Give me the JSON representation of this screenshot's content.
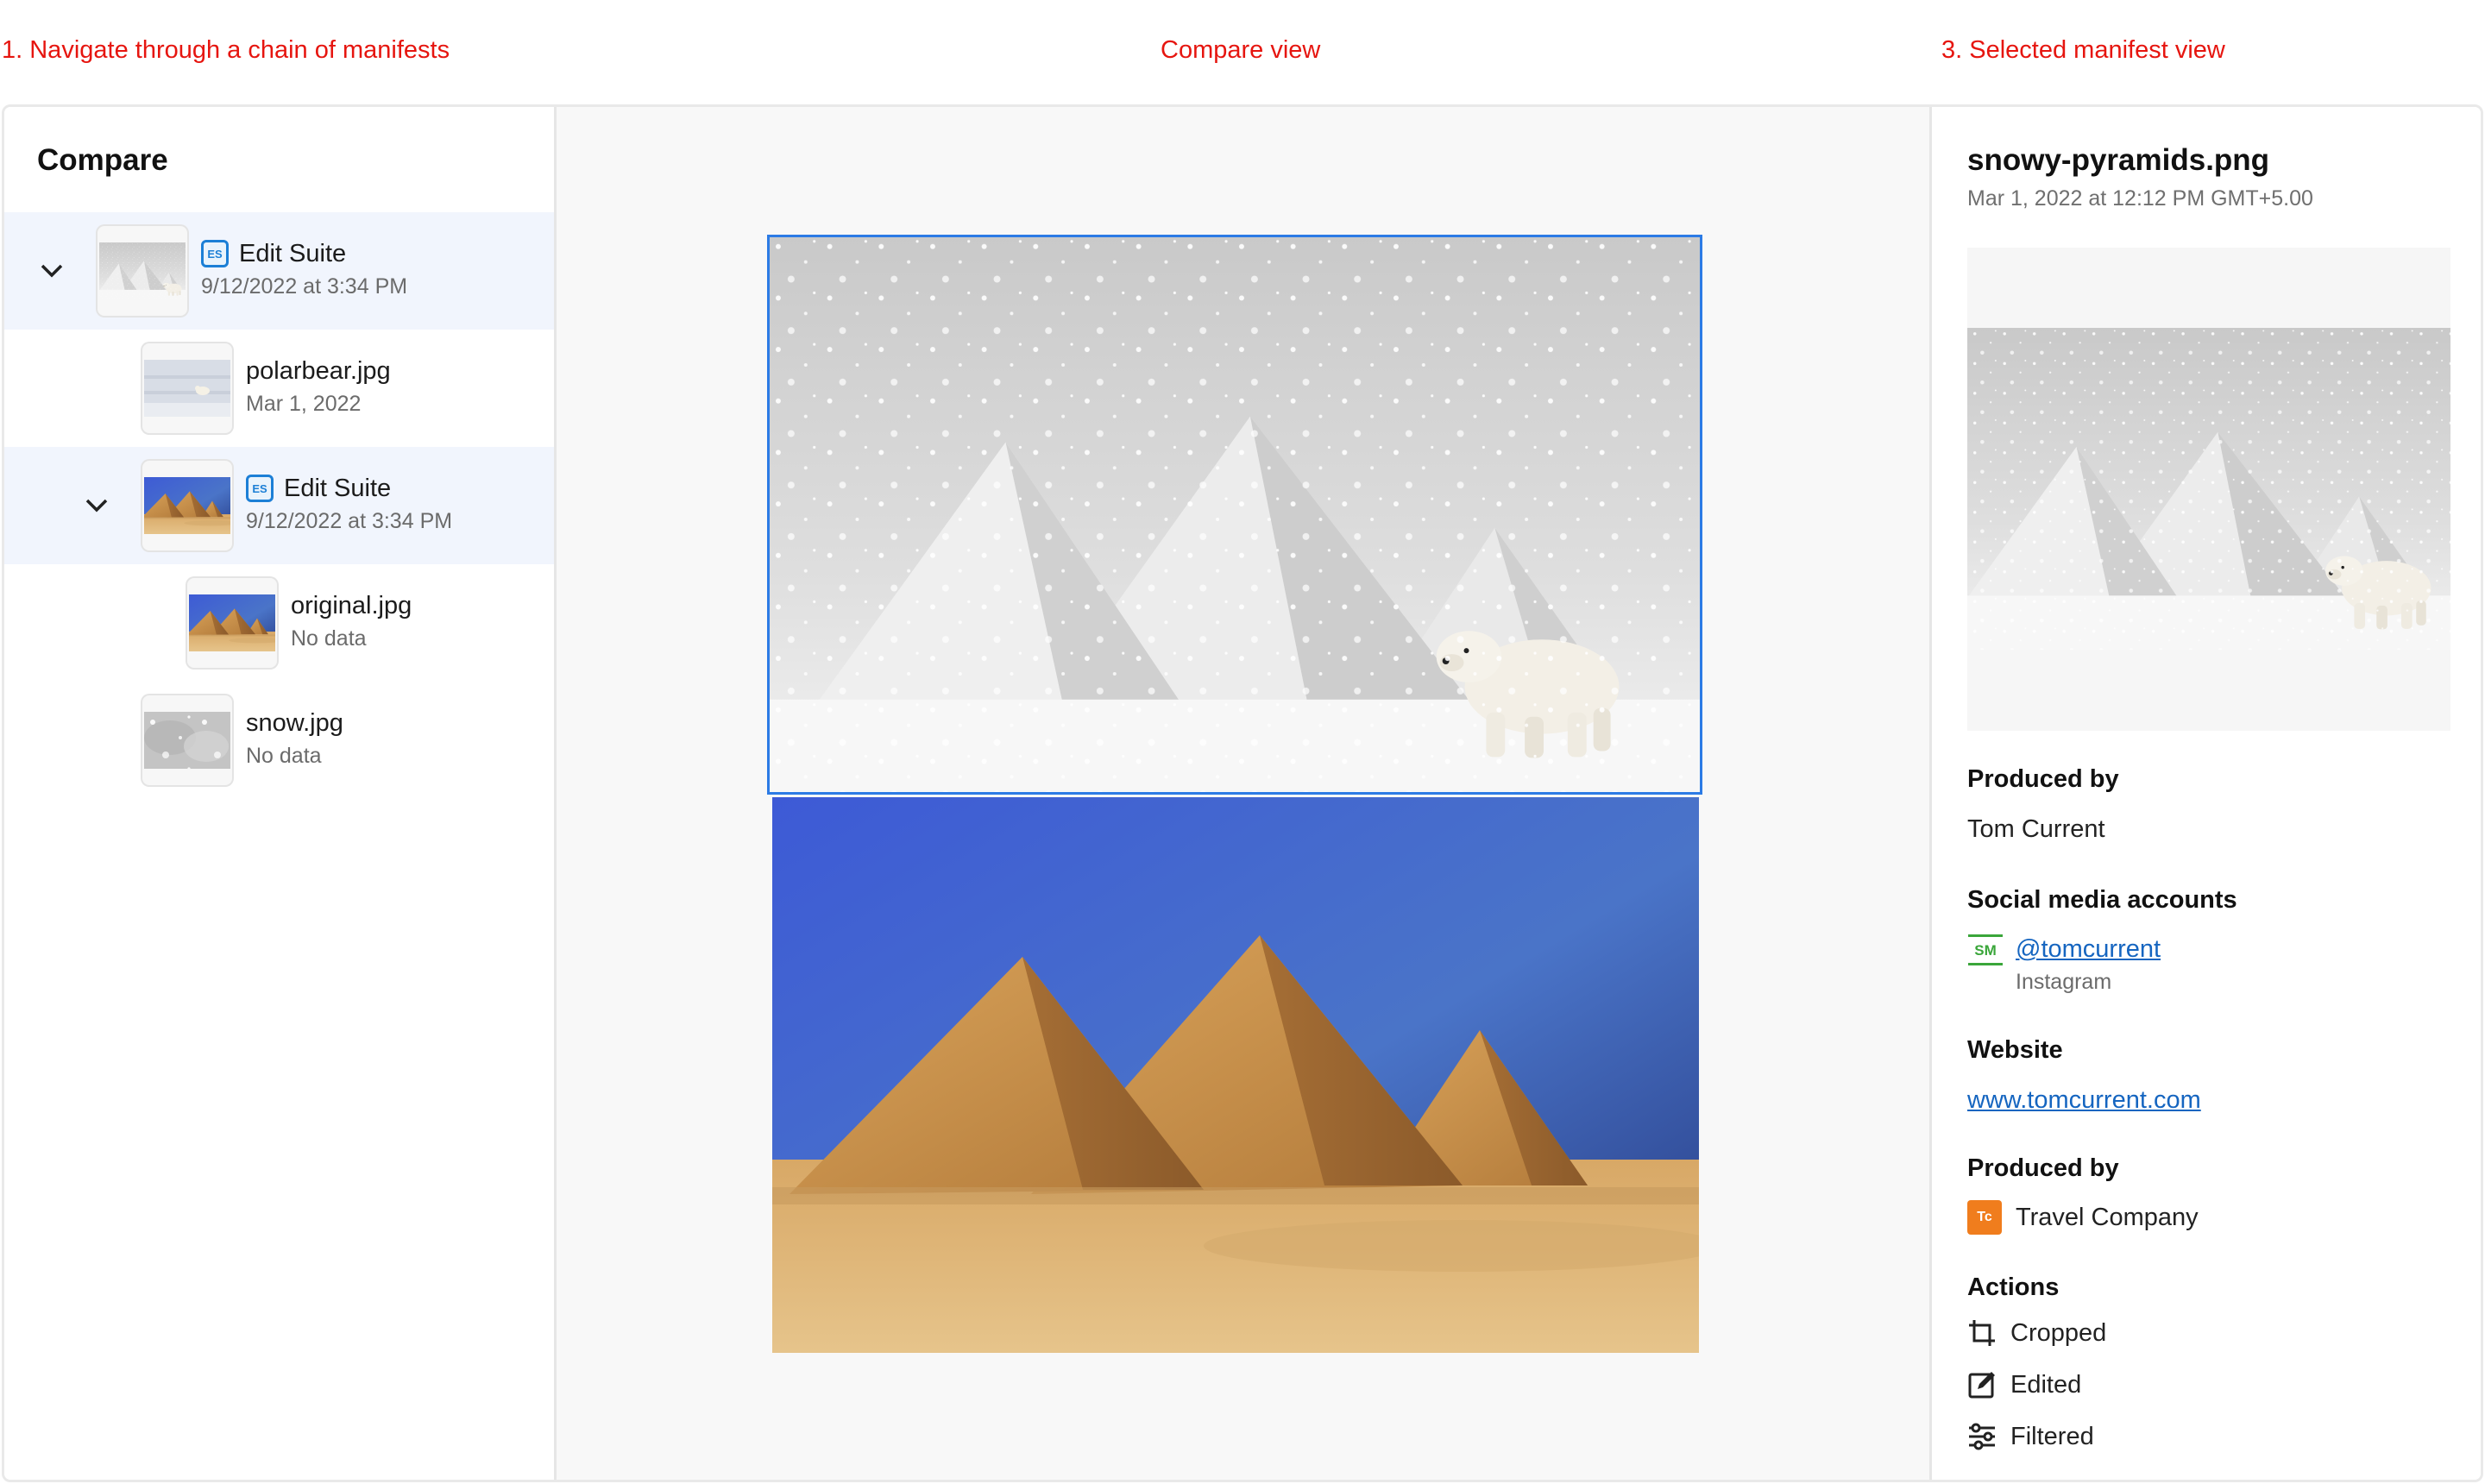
{
  "captions": {
    "navigate": "1. Navigate through a chain of manifests",
    "compare": "Compare view",
    "selected": "3. Selected manifest view"
  },
  "left_panel": {
    "title": "Compare",
    "tree": [
      {
        "name": "Edit Suite",
        "sub": "9/12/2022 at 3:34 PM",
        "badge": "ES",
        "expanded": true,
        "selected": true,
        "level": 0,
        "thumb": "snowy-pyramids"
      },
      {
        "name": "polarbear.jpg",
        "sub": "Mar 1, 2022",
        "level": 1,
        "thumb": "polarbear"
      },
      {
        "name": "Edit Suite",
        "sub": "9/12/2022 at 3:34 PM",
        "badge": "ES",
        "expanded": true,
        "selected": true,
        "level": 1,
        "thumb": "desert-pyramids"
      },
      {
        "name": "original.jpg",
        "sub": "No data",
        "level": 2,
        "thumb": "desert-pyramids"
      },
      {
        "name": "snow.jpg",
        "sub": "No data",
        "level": 1,
        "thumb": "snow"
      }
    ]
  },
  "compare_view": {
    "top_image": "snowy-pyramids-with-polar-bear",
    "bottom_image": "desert-pyramids"
  },
  "right_panel": {
    "title": "snowy-pyramids.png",
    "date": "Mar 1, 2022 at 12:12 PM GMT+5.00",
    "produced_by_label": "Produced by",
    "produced_by_value": "Tom Current",
    "social_label": "Social media accounts",
    "social_badge": "SM",
    "social_handle": "@tomcurrent",
    "social_platform": "Instagram",
    "website_label": "Website",
    "website_value": "www.tomcurrent.com",
    "produced_by_label_2": "Produced by",
    "company_badge": "Tc",
    "company_name": "Travel Company",
    "actions_label": "Actions",
    "actions": [
      "Cropped",
      "Edited",
      "Filtered"
    ]
  },
  "colors": {
    "accent": "#2c7be5",
    "caption": "#e6150f",
    "link": "#1565c0",
    "es_badge": "#1c7fd6",
    "sm_badge": "#3aa63a",
    "tc_badge": "#f07d1d"
  }
}
